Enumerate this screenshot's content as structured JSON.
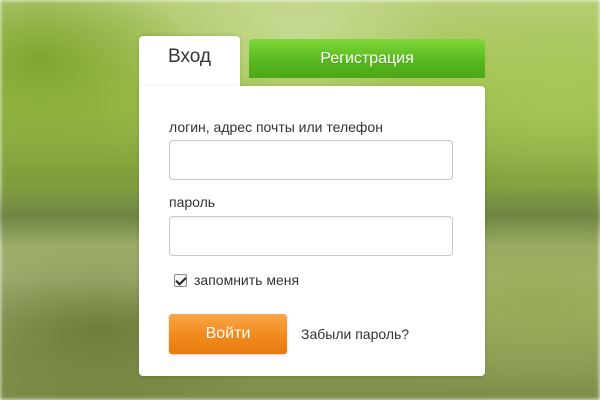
{
  "tabs": {
    "login_label": "Вход",
    "register_label": "Регистрация"
  },
  "form": {
    "login_label": "логин, адрес почты или телефон",
    "login_value": "",
    "password_label": "пароль",
    "password_value": "",
    "remember_label": "запомнить меня",
    "remember_checked": true,
    "submit_label": "Войти",
    "forgot_label": "Забыли пароль?"
  },
  "colors": {
    "register_tab": "#56b61d",
    "submit_button": "#f18a1d",
    "card_background": "#ffffff"
  },
  "icons": {
    "remember_checkbox": "checkmark-icon"
  }
}
